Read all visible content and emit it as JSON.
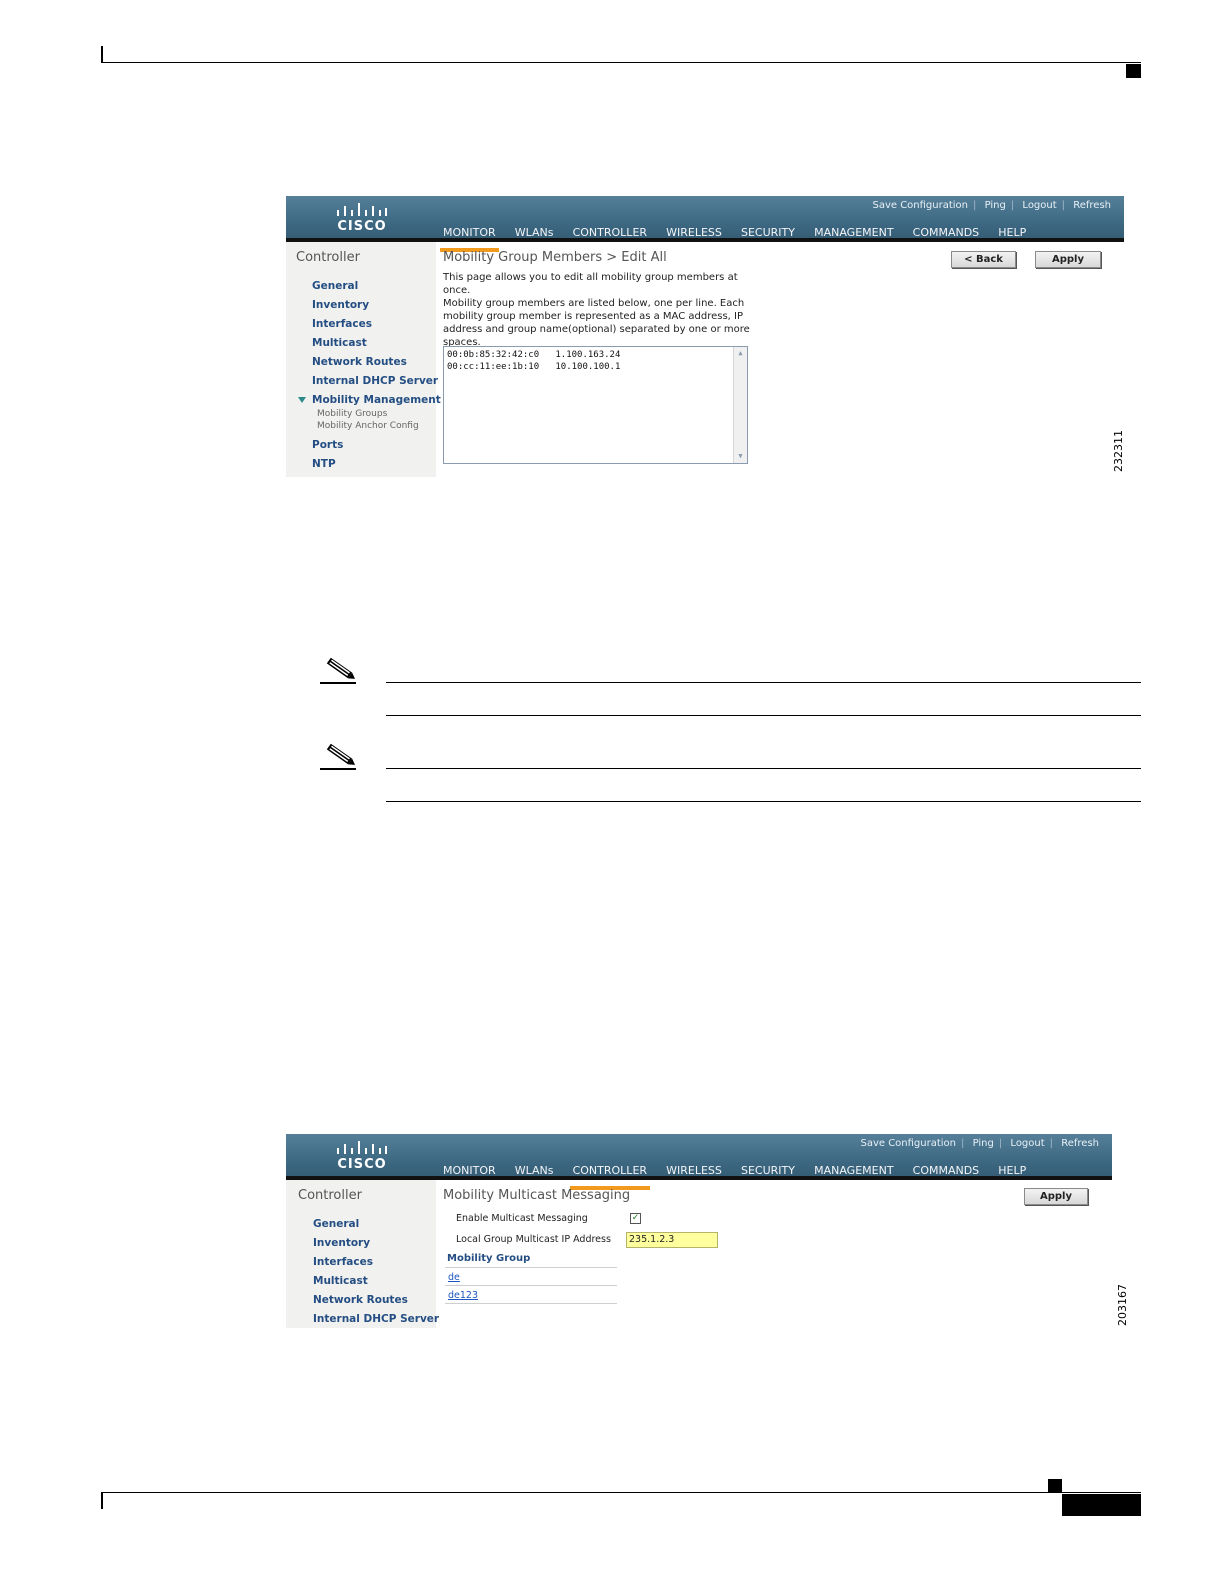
{
  "figure1": {
    "top_links": [
      "Save Configuration",
      "Ping",
      "Logout",
      "Refresh"
    ],
    "logo_text": "CISCO",
    "nav_tabs": [
      "MONITOR",
      "WLANs",
      "CONTROLLER",
      "WIRELESS",
      "SECURITY",
      "MANAGEMENT",
      "COMMANDS",
      "HELP"
    ],
    "active_tab": "MONITOR",
    "sidebar_title": "Controller",
    "sidebar_items": [
      "General",
      "Inventory",
      "Interfaces",
      "Multicast",
      "Network Routes",
      "Internal DHCP Server",
      "Mobility Management"
    ],
    "sidebar_subitems": [
      "Mobility Groups",
      "Mobility Anchor Config"
    ],
    "sidebar_items_after": [
      "Ports",
      "NTP"
    ],
    "page_title": "Mobility Group Members > Edit All",
    "back_button": "< Back",
    "apply_button": "Apply",
    "description_lines": [
      "This page allows you to edit all mobility group members at once.",
      "Mobility group members are listed below, one per line. Each",
      "mobility group member is represented as a MAC address, IP",
      "address and group name(optional) separated by one or more",
      "spaces."
    ],
    "members": [
      "00:0b:85:32:42:c0   1.100.163.24",
      "00:cc:11:ee:1b:10   10.100.100.1"
    ],
    "figure_number": "232311"
  },
  "figure2": {
    "top_links": [
      "Save Configuration",
      "Ping",
      "Logout",
      "Refresh"
    ],
    "logo_text": "CISCO",
    "nav_tabs": [
      "MONITOR",
      "WLANs",
      "CONTROLLER",
      "WIRELESS",
      "SECURITY",
      "MANAGEMENT",
      "COMMANDS",
      "HELP"
    ],
    "active_tab": "CONTROLLER",
    "sidebar_title": "Controller",
    "sidebar_items": [
      "General",
      "Inventory",
      "Interfaces",
      "Multicast",
      "Network Routes",
      "Internal DHCP Server"
    ],
    "page_title": "Mobility Multicast Messaging",
    "apply_button": "Apply",
    "enable_label": "Enable Multicast Messaging",
    "enable_checked": true,
    "check_mark": "✓",
    "ip_label": "Local Group Multicast IP Address",
    "ip_value": "235.1.2.3",
    "group_header": "Mobility Group",
    "groups": [
      "de",
      "de123"
    ],
    "figure_number": "203167"
  }
}
